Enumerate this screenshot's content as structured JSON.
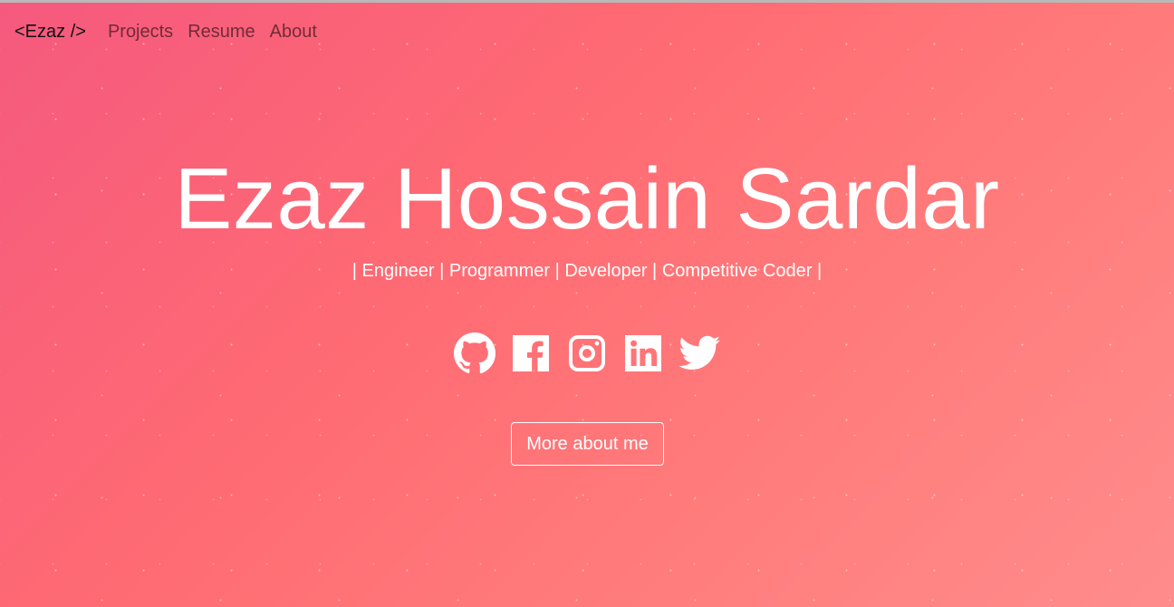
{
  "navbar": {
    "brand": "<Ezaz />",
    "links": [
      "Projects",
      "Resume",
      "About"
    ]
  },
  "hero": {
    "name": "Ezaz Hossain Sardar",
    "tagline": "| Engineer | Programmer | Developer | Competitive Coder |"
  },
  "social": {
    "icons": [
      "github-icon",
      "facebook-icon",
      "instagram-icon",
      "linkedin-icon",
      "twitter-icon"
    ]
  },
  "cta": {
    "label": "More about me"
  },
  "colors": {
    "gradient_start": "#f5597e",
    "gradient_end": "#ff8c8c",
    "text_light": "#ffffff"
  }
}
